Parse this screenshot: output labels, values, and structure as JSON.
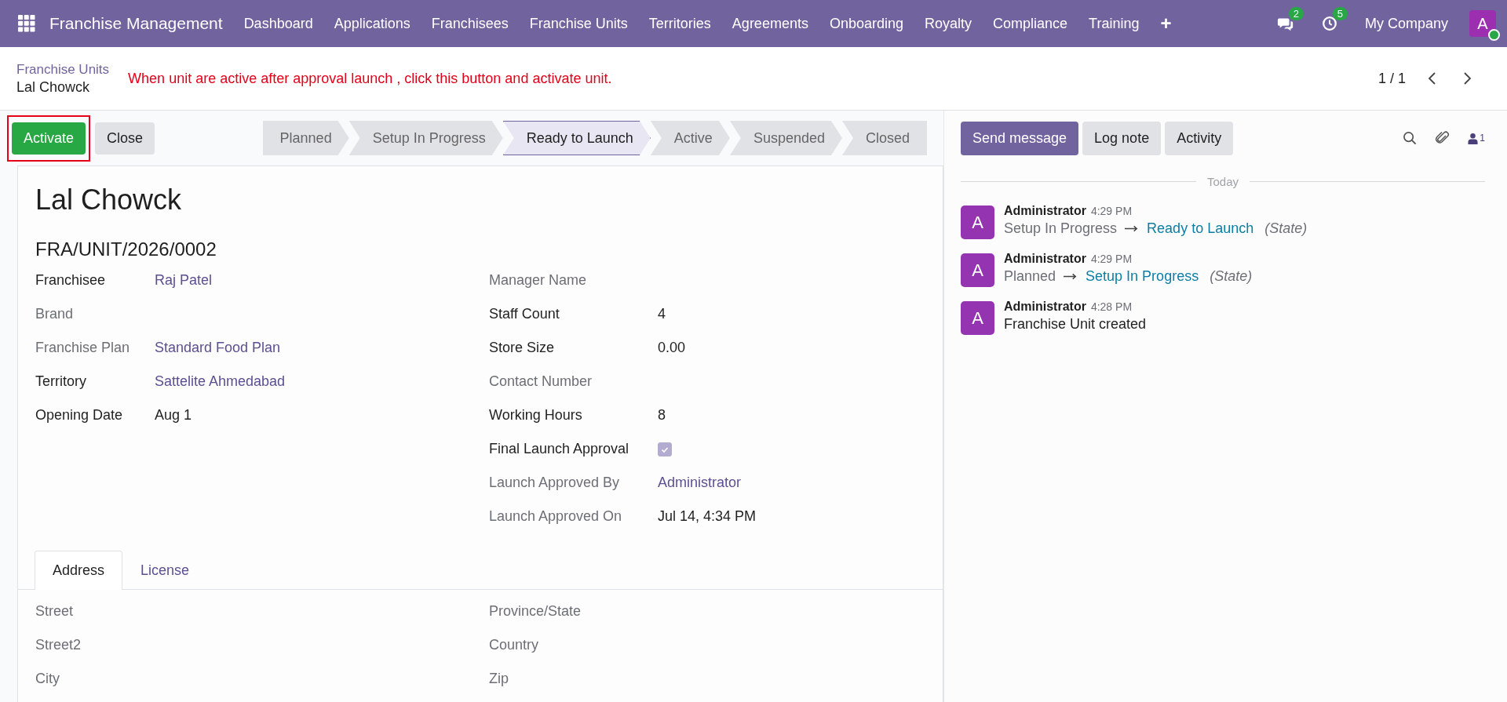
{
  "navbar": {
    "app_name": "Franchise Management",
    "menu": [
      "Dashboard",
      "Applications",
      "Franchisees",
      "Franchise Units",
      "Territories",
      "Agreements",
      "Onboarding",
      "Royalty",
      "Compliance",
      "Training"
    ],
    "plus": "+",
    "messages_badge": "2",
    "activities_badge": "5",
    "company": "My Company",
    "avatar": "A",
    "online": true
  },
  "breadcrumb": {
    "parent": "Franchise Units",
    "current": "Lal Chowck",
    "annotation": "When unit are active after approval launch , click this button and activate unit.",
    "pager": "1 / 1"
  },
  "actions": [
    {
      "label": "Activate",
      "kind": "primary",
      "highlighted": true
    },
    {
      "label": "Close",
      "kind": "secondary",
      "highlighted": false
    }
  ],
  "stages": [
    {
      "label": "Planned",
      "selected": false
    },
    {
      "label": "Setup In Progress",
      "selected": false
    },
    {
      "label": "Ready to Launch",
      "selected": true
    },
    {
      "label": "Active",
      "selected": false
    },
    {
      "label": "Suspended",
      "selected": false
    },
    {
      "label": "Closed",
      "selected": false
    }
  ],
  "form": {
    "title": "Lal Chowck",
    "reference": "FRA/UNIT/2026/0002",
    "left_fields": [
      {
        "label": "Franchisee",
        "muted": false,
        "kind": "link",
        "value": "Raj Patel"
      },
      {
        "label": "Brand",
        "muted": true,
        "kind": "empty"
      },
      {
        "label": "Franchise Plan",
        "muted": true,
        "kind": "link",
        "value": "Standard Food Plan"
      },
      {
        "label": "Territory",
        "muted": false,
        "kind": "link",
        "value": "Sattelite Ahmedabad"
      },
      {
        "label": "Opening Date",
        "muted": false,
        "kind": "text",
        "value": "Aug 1"
      }
    ],
    "right_fields": [
      {
        "label": "Manager Name",
        "muted": true,
        "kind": "empty"
      },
      {
        "label": "Staff Count",
        "muted": false,
        "kind": "text",
        "value": "4"
      },
      {
        "label": "Store Size",
        "muted": false,
        "kind": "text",
        "value": "0.00"
      },
      {
        "label": "Contact Number",
        "muted": true,
        "kind": "empty"
      },
      {
        "label": "Working Hours",
        "muted": false,
        "kind": "text",
        "value": "8"
      },
      {
        "label": "Final Launch Approval",
        "muted": false,
        "kind": "checkbox",
        "checked": true
      },
      {
        "label": "Launch Approved By",
        "muted": true,
        "kind": "link",
        "value": "Administrator"
      },
      {
        "label": "Launch Approved On",
        "muted": true,
        "kind": "text",
        "value": "Jul 14, 4:34 PM"
      }
    ],
    "tabs": [
      {
        "label": "Address",
        "selected": true
      },
      {
        "label": "License",
        "selected": false
      }
    ],
    "address_left": [
      "Street",
      "Street2",
      "City"
    ],
    "address_right": [
      "Province/State",
      "Country",
      "Zip"
    ]
  },
  "chatter": {
    "buttons": [
      {
        "label": "Send message",
        "kind": "primary"
      },
      {
        "label": "Log note",
        "kind": "secondary"
      },
      {
        "label": "Activity",
        "kind": "secondary"
      }
    ],
    "followers": "1",
    "divider": "Today",
    "messages": [
      {
        "avatar": "A",
        "author": "Administrator",
        "time": "4:29 PM",
        "kind": "tracking",
        "old": "Setup In Progress",
        "new": "Ready to Launch",
        "field": "(State)"
      },
      {
        "avatar": "A",
        "author": "Administrator",
        "time": "4:29 PM",
        "kind": "tracking",
        "old": "Planned",
        "new": "Setup In Progress",
        "field": "(State)"
      },
      {
        "avatar": "A",
        "author": "Administrator",
        "time": "4:28 PM",
        "kind": "text",
        "body": "Franchise Unit created"
      }
    ]
  }
}
